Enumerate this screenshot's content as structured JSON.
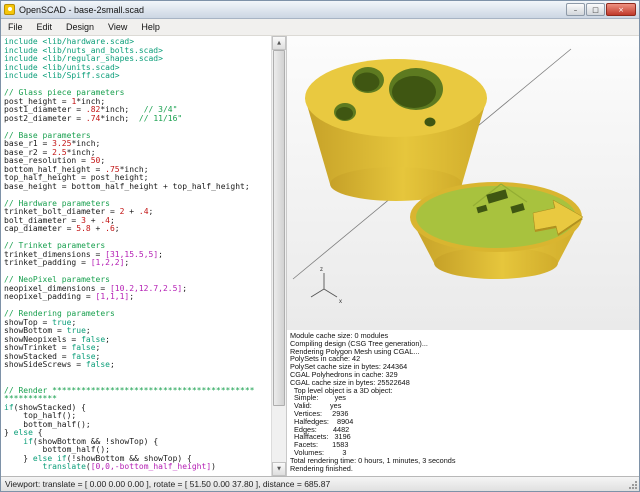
{
  "window": {
    "title": "OpenSCAD - base-2small.scad",
    "controls": {
      "minimize": "–",
      "maximize": "□",
      "close": "×"
    }
  },
  "menu": {
    "items": [
      "File",
      "Edit",
      "Design",
      "View",
      "Help"
    ]
  },
  "icons": {
    "scroll_up": "▲",
    "scroll_down": "▼"
  },
  "colors": {
    "code_default": "#1a1a1a",
    "code_include": "#0b9e79",
    "code_comment": "#19a04f",
    "code_keyword": "#0b9e79",
    "code_number": "#c21414",
    "code_vector": "#b520b5",
    "part_yellow_top": "#e9c940",
    "part_yellow_side": "#d9b530",
    "part_green_face": "#a8c23e",
    "hole_rim": "#5d7a20",
    "hole_dark": "#3f5612",
    "axis_line": "#7d7d7d"
  },
  "editor": {
    "lines": [
      [
        [
          "inc",
          "include <lib/hardware.scad>"
        ]
      ],
      [
        [
          "inc",
          "include <lib/nuts_and_bolts.scad>"
        ]
      ],
      [
        [
          "inc",
          "include <lib/regular_shapes.scad>"
        ]
      ],
      [
        [
          "inc",
          "include <lib/units.scad>"
        ]
      ],
      [
        [
          "inc",
          "include <lib/Spiff.scad>"
        ]
      ],
      [],
      [
        [
          "com",
          "// Glass piece parameters"
        ]
      ],
      [
        [
          "id",
          "post_height = "
        ],
        [
          "num",
          "1"
        ],
        [
          "id",
          "*inch;"
        ]
      ],
      [
        [
          "id",
          "post1_diameter = "
        ],
        [
          "num",
          ".82"
        ],
        [
          "id",
          "*inch;"
        ],
        [
          "com",
          "   // 3/4\""
        ]
      ],
      [
        [
          "id",
          "post2_diameter = "
        ],
        [
          "num",
          ".74"
        ],
        [
          "id",
          "*inch;"
        ],
        [
          "com",
          "  // 11/16\""
        ]
      ],
      [],
      [
        [
          "com",
          "// Base parameters"
        ]
      ],
      [
        [
          "id",
          "base_r1 = "
        ],
        [
          "num",
          "3.25"
        ],
        [
          "id",
          "*inch;"
        ]
      ],
      [
        [
          "id",
          "base_r2 = "
        ],
        [
          "num",
          "2.5"
        ],
        [
          "id",
          "*inch;"
        ]
      ],
      [
        [
          "id",
          "base_resolution = "
        ],
        [
          "num",
          "50"
        ],
        [
          "id",
          ";"
        ]
      ],
      [
        [
          "id",
          "bottom_half_height = "
        ],
        [
          "num",
          ".75"
        ],
        [
          "id",
          "*inch;"
        ]
      ],
      [
        [
          "id",
          "top_half_height = post_height;"
        ]
      ],
      [
        [
          "id",
          "base_height = bottom_half_height + top_half_height;"
        ]
      ],
      [],
      [
        [
          "com",
          "// Hardware parameters"
        ]
      ],
      [
        [
          "id",
          "trinket_bolt_diameter = "
        ],
        [
          "num",
          "2"
        ],
        [
          "id",
          " + "
        ],
        [
          "num",
          ".4"
        ],
        [
          "id",
          ";"
        ]
      ],
      [
        [
          "id",
          "bolt_diameter = "
        ],
        [
          "num",
          "3"
        ],
        [
          "id",
          " + "
        ],
        [
          "num",
          ".4"
        ],
        [
          "id",
          ";"
        ]
      ],
      [
        [
          "id",
          "cap_diameter = "
        ],
        [
          "num",
          "5.8"
        ],
        [
          "id",
          " + "
        ],
        [
          "num",
          ".6"
        ],
        [
          "id",
          ";"
        ]
      ],
      [],
      [
        [
          "com",
          "// Trinket parameters"
        ]
      ],
      [
        [
          "id",
          "trinket_dimensions = "
        ],
        [
          "vec",
          "[31,15.5,5]"
        ],
        [
          "id",
          ";"
        ]
      ],
      [
        [
          "id",
          "trinket_padding = "
        ],
        [
          "vec",
          "[1,2,2]"
        ],
        [
          "id",
          ";"
        ]
      ],
      [],
      [
        [
          "com",
          "// NeoPixel parameters"
        ]
      ],
      [
        [
          "id",
          "neopixel_dimensions = "
        ],
        [
          "vec",
          "[10.2,12.7,2.5]"
        ],
        [
          "id",
          ";"
        ]
      ],
      [
        [
          "id",
          "neopixel_padding = "
        ],
        [
          "vec",
          "[1,1,1]"
        ],
        [
          "id",
          ";"
        ]
      ],
      [],
      [
        [
          "com",
          "// Rendering parameters"
        ]
      ],
      [
        [
          "id",
          "showTop = "
        ],
        [
          "kw",
          "true"
        ],
        [
          "id",
          ";"
        ]
      ],
      [
        [
          "id",
          "showBottom = "
        ],
        [
          "kw",
          "true"
        ],
        [
          "id",
          ";"
        ]
      ],
      [
        [
          "id",
          "showNeopixels = "
        ],
        [
          "kw",
          "false"
        ],
        [
          "id",
          ";"
        ]
      ],
      [
        [
          "id",
          "showTrinket = "
        ],
        [
          "kw",
          "false"
        ],
        [
          "id",
          ";"
        ]
      ],
      [
        [
          "id",
          "showStacked = "
        ],
        [
          "kw",
          "false"
        ],
        [
          "id",
          ";"
        ]
      ],
      [
        [
          "id",
          "showSideScrews = "
        ],
        [
          "kw",
          "false"
        ],
        [
          "id",
          ";"
        ]
      ],
      [],
      [],
      [
        [
          "com",
          "// Render ******************************************"
        ]
      ],
      [
        [
          "com",
          "***********"
        ]
      ],
      [
        [
          "kw",
          "if"
        ],
        [
          "id",
          "(showStacked) {"
        ]
      ],
      [
        [
          "id",
          "    top_half();"
        ]
      ],
      [
        [
          "id",
          "    bottom_half();"
        ]
      ],
      [
        [
          "id",
          "} "
        ],
        [
          "kw",
          "else"
        ],
        [
          "id",
          " {"
        ]
      ],
      [
        [
          "id",
          "    "
        ],
        [
          "kw",
          "if"
        ],
        [
          "id",
          "(showBottom && !showTop) {"
        ]
      ],
      [
        [
          "id",
          "        bottom_half();"
        ]
      ],
      [
        [
          "id",
          "    } "
        ],
        [
          "kw",
          "else if"
        ],
        [
          "id",
          "(!showBottom && showTop) {"
        ]
      ],
      [
        [
          "id",
          "        "
        ],
        [
          "kw",
          "translate"
        ],
        [
          "id",
          "("
        ],
        [
          "vec",
          "[0,0,-bottom_half_height]"
        ],
        [
          "id",
          ")"
        ]
      ]
    ]
  },
  "viewport3d": {
    "axis_labels": [
      "z",
      "x"
    ],
    "objects": [
      "top-half-frustum",
      "bottom-half-frustum"
    ]
  },
  "console": {
    "lines": [
      "Module cache size: 0 modules",
      "Compiling design (CSG Tree generation)...",
      "Rendering Polygon Mesh using CGAL...",
      "PolySets in cache: 42",
      "PolySet cache size in bytes: 244364",
      "CGAL Polyhedrons in cache: 329",
      "CGAL cache size in bytes: 25522648",
      "  Top level object is a 3D object:",
      "  Simple:        yes",
      "  Valid:         yes",
      "  Vertices:     2936",
      "  Halfedges:    8904",
      "  Edges:        4482",
      "  Halffacets:   3196",
      "  Facets:       1583",
      "  Volumes:         3",
      "Total rendering time: 0 hours, 1 minutes, 3 seconds",
      "Rendering finished."
    ]
  },
  "status": {
    "text": "Viewport: translate = [ 0.00 0.00 0.00 ], rotate = [ 51.50 0.00 37.80 ], distance = 685.87"
  }
}
